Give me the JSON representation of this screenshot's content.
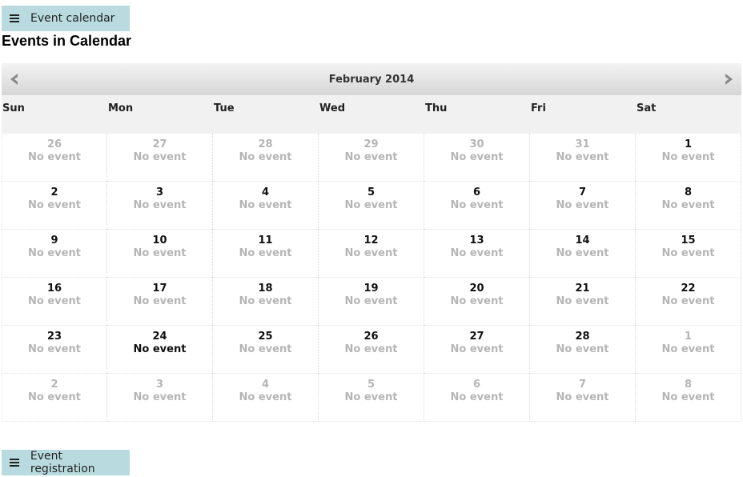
{
  "top_button": {
    "label": "Event calendar"
  },
  "page_title": "Events in Calendar",
  "calendar": {
    "month_label": "February 2014",
    "weekdays": [
      "Sun",
      "Mon",
      "Tue",
      "Wed",
      "Thu",
      "Fri",
      "Sat"
    ],
    "weeks": [
      [
        {
          "day": "26",
          "event": "No event",
          "other_month": true
        },
        {
          "day": "27",
          "event": "No event",
          "other_month": true
        },
        {
          "day": "28",
          "event": "No event",
          "other_month": true
        },
        {
          "day": "29",
          "event": "No event",
          "other_month": true
        },
        {
          "day": "30",
          "event": "No event",
          "other_month": true
        },
        {
          "day": "31",
          "event": "No event",
          "other_month": true
        },
        {
          "day": "1",
          "event": "No event",
          "other_month": false
        }
      ],
      [
        {
          "day": "2",
          "event": "No event",
          "other_month": false
        },
        {
          "day": "3",
          "event": "No event",
          "other_month": false
        },
        {
          "day": "4",
          "event": "No event",
          "other_month": false
        },
        {
          "day": "5",
          "event": "No event",
          "other_month": false
        },
        {
          "day": "6",
          "event": "No event",
          "other_month": false
        },
        {
          "day": "7",
          "event": "No event",
          "other_month": false
        },
        {
          "day": "8",
          "event": "No event",
          "other_month": false
        }
      ],
      [
        {
          "day": "9",
          "event": "No event",
          "other_month": false
        },
        {
          "day": "10",
          "event": "No event",
          "other_month": false
        },
        {
          "day": "11",
          "event": "No event",
          "other_month": false
        },
        {
          "day": "12",
          "event": "No event",
          "other_month": false
        },
        {
          "day": "13",
          "event": "No event",
          "other_month": false
        },
        {
          "day": "14",
          "event": "No event",
          "other_month": false
        },
        {
          "day": "15",
          "event": "No event",
          "other_month": false
        }
      ],
      [
        {
          "day": "16",
          "event": "No event",
          "other_month": false
        },
        {
          "day": "17",
          "event": "No event",
          "other_month": false
        },
        {
          "day": "18",
          "event": "No event",
          "other_month": false
        },
        {
          "day": "19",
          "event": "No event",
          "other_month": false
        },
        {
          "day": "20",
          "event": "No event",
          "other_month": false
        },
        {
          "day": "21",
          "event": "No event",
          "other_month": false
        },
        {
          "day": "22",
          "event": "No event",
          "other_month": false
        }
      ],
      [
        {
          "day": "23",
          "event": "No event",
          "other_month": false
        },
        {
          "day": "24",
          "event": "No event",
          "other_month": false,
          "today": true
        },
        {
          "day": "25",
          "event": "No event",
          "other_month": false
        },
        {
          "day": "26",
          "event": "No event",
          "other_month": false
        },
        {
          "day": "27",
          "event": "No event",
          "other_month": false
        },
        {
          "day": "28",
          "event": "No event",
          "other_month": false
        },
        {
          "day": "1",
          "event": "No event",
          "other_month": true
        }
      ],
      [
        {
          "day": "2",
          "event": "No event",
          "other_month": true
        },
        {
          "day": "3",
          "event": "No event",
          "other_month": true
        },
        {
          "day": "4",
          "event": "No event",
          "other_month": true
        },
        {
          "day": "5",
          "event": "No event",
          "other_month": true
        },
        {
          "day": "6",
          "event": "No event",
          "other_month": true
        },
        {
          "day": "7",
          "event": "No event",
          "other_month": true
        },
        {
          "day": "8",
          "event": "No event",
          "other_month": true
        }
      ]
    ]
  },
  "bottom_button": {
    "label": "Event registration"
  },
  "icons": {
    "menu": "hamburger-menu-icon",
    "prev": "chevron-left-icon",
    "next": "chevron-right-icon"
  },
  "colors": {
    "button_bg": "#b9dbdf",
    "muted_text": "#b5b5b5",
    "weekday_bg": "#f1f1f1"
  }
}
